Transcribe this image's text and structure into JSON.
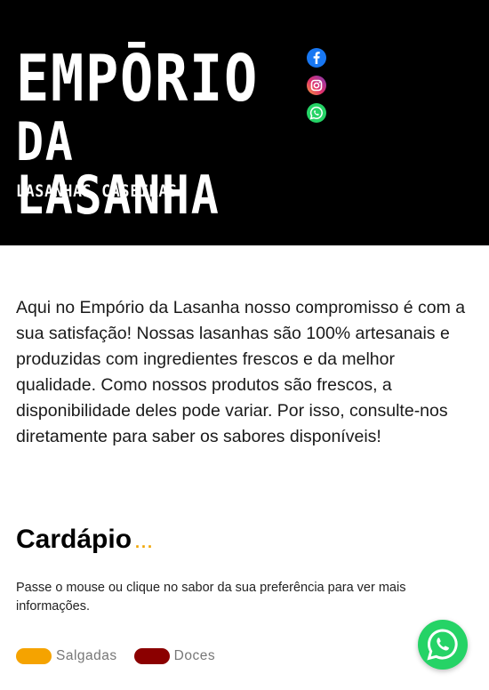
{
  "header": {
    "logo_line1": "EMPŌRIO",
    "logo_line2": "DA LASANHA",
    "tagline": "LASANHAS CASEIRAS"
  },
  "social": {
    "items": [
      {
        "name": "facebook-icon",
        "color": "#1877f2"
      },
      {
        "name": "instagram-icon",
        "color": "#e1306c"
      },
      {
        "name": "whatsapp-icon",
        "color": "#25d366"
      }
    ]
  },
  "intro": {
    "text": "Aqui no Empório da Lasanha nosso compromisso é com a sua satisfação! Nossas lasanhas são 100% artesanais e produzidas com ingredientes frescos e da melhor qualidade. Como nossos produtos são frescos, a disponibilidade deles pode variar. Por isso, consulte-nos diretamente para saber os sabores disponíveis!"
  },
  "menu": {
    "title": "Cardápio",
    "title_dots": "...",
    "instruction": "Passe o mouse ou clique no sabor da sua preferência para ver mais informações.",
    "legend": [
      {
        "label": "Salgadas",
        "color": "#f5a300"
      },
      {
        "label": "Doces",
        "color": "#8b0000"
      }
    ]
  },
  "floating_whatsapp": {
    "icon": "whatsapp-icon",
    "color": "#25d366"
  }
}
